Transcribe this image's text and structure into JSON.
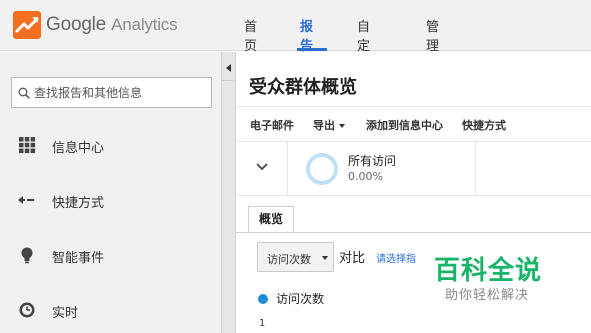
{
  "header": {
    "logo_word": "Google",
    "logo_product": "Analytics",
    "nav": [
      {
        "label": "首页"
      },
      {
        "label": "报告"
      },
      {
        "label": "自定义"
      },
      {
        "label": "管理"
      }
    ],
    "active_nav": "报告",
    "accent_color": "#2a6ed4"
  },
  "sidebar": {
    "search_placeholder": "查找报告和其他信息",
    "items": [
      {
        "label": "信息中心",
        "icon": "grid-icon"
      },
      {
        "label": "快捷方式",
        "icon": "shortcut-arrow-icon"
      },
      {
        "label": "智能事件",
        "icon": "lightbulb-icon"
      },
      {
        "label": "实时",
        "icon": "clock-icon"
      }
    ]
  },
  "main": {
    "title": "受众群体概览",
    "toolbar": {
      "email": "电子邮件",
      "export": "导出",
      "add_to_dashboard": "添加到信息中心",
      "shortcut": "快捷方式"
    },
    "segment": {
      "name": "所有访问",
      "percent": "0.00%"
    },
    "tab": "概览",
    "metric_select": "访问次数",
    "vs_label": "对比",
    "choose_metric": "请选择指",
    "legend_label": "访问次数",
    "legend_color": "#1f8dd6",
    "axis_tick": "1"
  },
  "watermark": {
    "title": "百科全说",
    "subtitle": "助你轻松解决",
    "color": "#19b46a"
  }
}
